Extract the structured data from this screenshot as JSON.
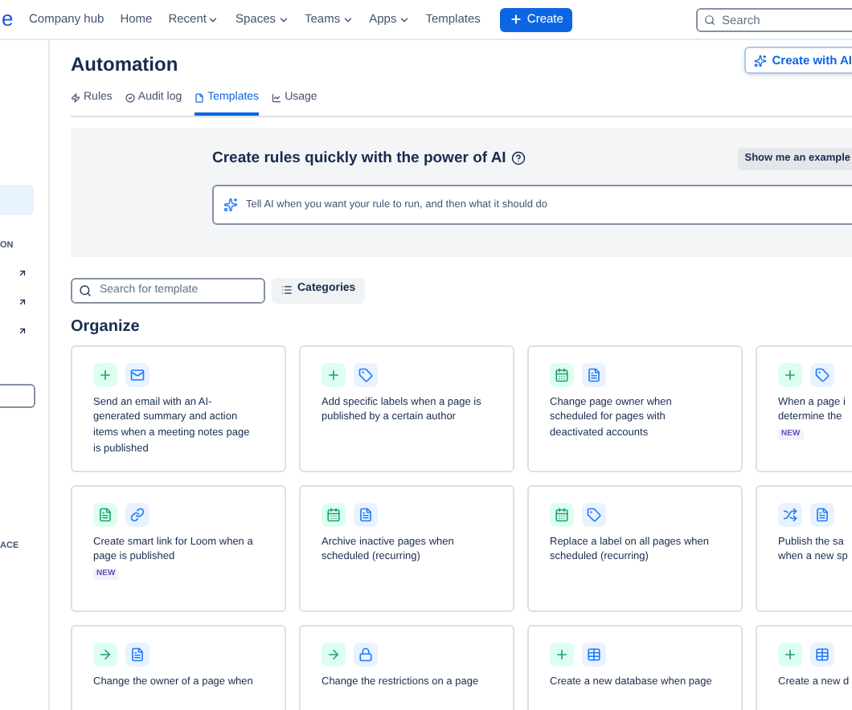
{
  "sidebar": {
    "logo_fragment": "e",
    "section_labels": [
      {
        "text": "ON"
      },
      {
        "text": "ACE"
      }
    ],
    "items": [
      {
        "selected": true
      }
    ]
  },
  "nav": {
    "items": [
      {
        "label": "Company hub",
        "dropdown": false
      },
      {
        "label": "Home",
        "dropdown": false
      },
      {
        "label": "Recent",
        "dropdown": true
      },
      {
        "label": "Spaces",
        "dropdown": true
      },
      {
        "label": "Teams",
        "dropdown": true
      },
      {
        "label": "Apps",
        "dropdown": true
      },
      {
        "label": "Templates",
        "dropdown": false
      }
    ],
    "create_button": "Create",
    "search": {
      "placeholder": "Search"
    }
  },
  "page": {
    "title": "Automation",
    "ai_button": "Create with AI"
  },
  "tabs": [
    {
      "label": "Rules",
      "selected": false
    },
    {
      "label": "Audit log",
      "selected": false
    },
    {
      "label": "Templates",
      "selected": true
    },
    {
      "label": "Usage",
      "selected": false
    }
  ],
  "ai_panel": {
    "heading": "Create rules quickly with the power of AI",
    "example_button": "Show me an example",
    "input": {
      "placeholder": "Tell AI when you want your rule to run, and then what it should do"
    }
  },
  "template_search": {
    "placeholder": "Search for template"
  },
  "categories_button": "Categories",
  "section": {
    "title": "Organize"
  },
  "cards": [
    {
      "icons": [
        {
          "kind": "plus"
        },
        {
          "kind": "mail"
        }
      ],
      "lines": [
        "Send an email with an AI-",
        "generated summary and action",
        "items when a meeting notes page",
        "is published"
      ]
    },
    {
      "icons": [
        {
          "kind": "plus"
        },
        {
          "kind": "tag"
        }
      ],
      "lines": [
        "Add specific labels when a page is",
        "published by a certain author"
      ]
    },
    {
      "icons": [
        {
          "kind": "calendar"
        },
        {
          "kind": "page"
        }
      ],
      "lines": [
        "Change page owner when",
        "scheduled for pages with",
        "deactivated accounts"
      ]
    },
    {
      "icons": [
        {
          "kind": "plus"
        },
        {
          "kind": "tag"
        }
      ],
      "lines": [
        "When a page i",
        "determine the"
      ],
      "badge": "NEW"
    },
    {
      "icons": [
        {
          "kind": "page"
        },
        {
          "kind": "link"
        }
      ],
      "lines": [
        "Create smart link for Loom when a",
        "page is published"
      ],
      "badge": "NEW"
    },
    {
      "icons": [
        {
          "kind": "calendar"
        },
        {
          "kind": "page"
        }
      ],
      "lines": [
        "Archive inactive pages when",
        "scheduled (recurring)"
      ]
    },
    {
      "icons": [
        {
          "kind": "calendar"
        },
        {
          "kind": "tag"
        }
      ],
      "lines": [
        "Replace a label on all pages when",
        "scheduled (recurring)"
      ]
    },
    {
      "icons": [
        {
          "kind": "shuffle"
        },
        {
          "kind": "page"
        }
      ],
      "lines": [
        "Publish the sa",
        "when a new sp"
      ]
    },
    {
      "icons": [
        {
          "kind": "arrow"
        },
        {
          "kind": "page"
        }
      ],
      "lines": [
        "Change the owner of a page when"
      ]
    },
    {
      "icons": [
        {
          "kind": "arrow"
        },
        {
          "kind": "lock"
        }
      ],
      "lines": [
        "Change the restrictions on a page"
      ]
    },
    {
      "icons": [
        {
          "kind": "plus"
        },
        {
          "kind": "table"
        }
      ],
      "lines": [
        "Create a new database when page"
      ]
    },
    {
      "icons": [
        {
          "kind": "plus"
        },
        {
          "kind": "table"
        }
      ],
      "lines": [
        "Create a new d"
      ]
    }
  ]
}
